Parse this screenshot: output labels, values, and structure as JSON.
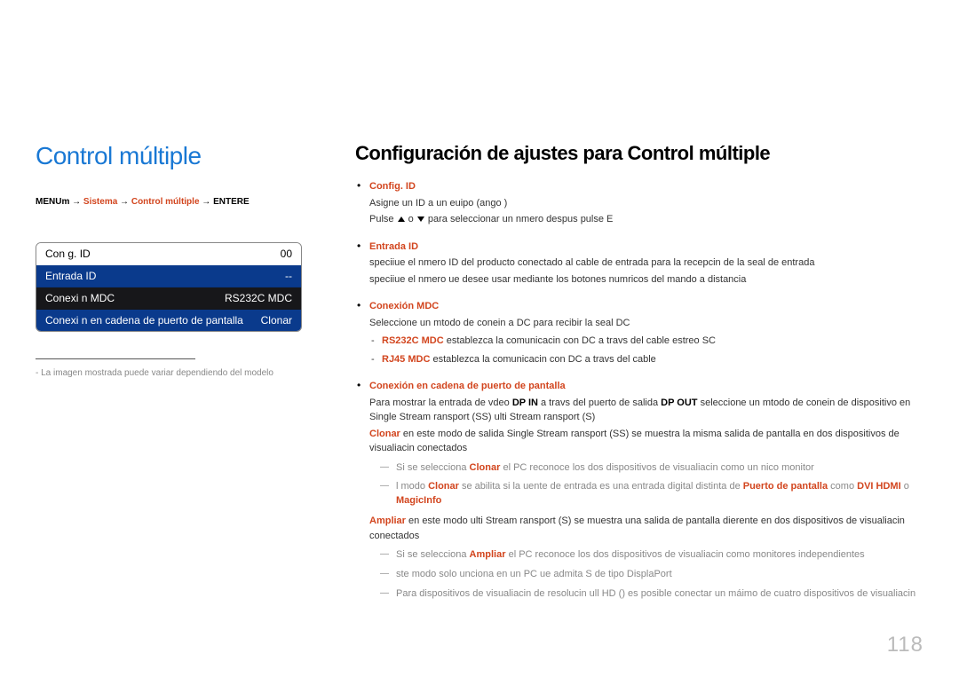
{
  "page_number": "118",
  "left": {
    "title": "Control múltiple",
    "nav": {
      "menu": "MENU",
      "m": "m",
      "arrow": " → ",
      "sistema": "Sistema",
      "control": "Control múltiple",
      "enter": "ENTER",
      "e": "E"
    },
    "menu_rows": [
      {
        "label": "Con g. ID",
        "value": "00",
        "cls": ""
      },
      {
        "label": "Entrada ID",
        "value": "--",
        "cls": "hl"
      },
      {
        "label": "Conexi n MDC",
        "value": "RS232C MDC",
        "cls": "dark"
      },
      {
        "label": "Conexi n en cadena de puerto de pantalla",
        "value": "Clonar",
        "cls": "hl"
      }
    ],
    "caption": "La imagen mostrada puede variar dependiendo del modelo"
  },
  "right": {
    "title": "Configuración de ajustes para Control múltiple",
    "items": {
      "config_id": {
        "title": "Config. ID",
        "line1a": "Asigne un ID a un euipo (ango ",
        "line1b": ")",
        "line2a": "Pulse ",
        "line2b": " o ",
        "line2c": " para seleccionar un nmero  despus pulse ",
        "line2d": "E"
      },
      "entrada_id": {
        "title": "Entrada ID",
        "line1": "speciiue el nmero ID del producto conectado al cable de entrada para la recepcin de la seal de entrada",
        "line2": "speciiue el nmero ue desee usar mediante los botones numricos del mando a distancia"
      },
      "conexion_mdc": {
        "title": "Conexión MDC",
        "intro": "Seleccione un mtodo de conein a DC para recibir la seal DC",
        "sub1_title": "RS232C MDC",
        "sub1_text": " establezca la comunicacin con DC a travs del cable estreo SC",
        "sub2_title": "RJ45 MDC",
        "sub2_text": " establezca la comunicacin con DC a travs del cable"
      },
      "daisy": {
        "title": "Conexión en cadena de puerto de pantalla",
        "intro_a": "Para mostrar la entrada de vdeo ",
        "dp_in": "DP IN",
        "intro_b": " a travs del puerto de salida ",
        "dp_out": "DP OUT",
        "intro_c": " seleccione un mtodo de conein de dispositivo en Single Stream ransport (SS)  ulti Stream ransport (S)",
        "clonar_title": "Clonar",
        "clonar_text": " en este modo de salida Single Stream ransport (SS) se muestra la misma salida de pantalla en dos dispositivos de visualiacin conectados",
        "note1_a": "Si se selecciona ",
        "note1_b": "Clonar",
        "note1_c": " el PC reconoce los dos dispositivos de visualiacin como un nico monitor",
        "note2_a": "l modo ",
        "note2_b": "Clonar",
        "note2_c": " se abilita si la uente de entrada es una entrada digital distinta de ",
        "note2_d": "Puerto de pantalla",
        "note2_e": " como ",
        "note2_f": "DVI",
        "note2_g": "HDMI",
        "note2_h": " o ",
        "note2_i": "MagicInfo",
        "ampliar_title": "Ampliar",
        "ampliar_text": " en este modo ulti Stream ransport (S) se muestra una salida de pantalla dierente en dos dispositivos de visualiacin conectados",
        "note3_a": "Si se selecciona ",
        "note3_b": "Ampliar",
        "note3_c": " el PC reconoce los dos dispositivos de visualiacin como monitores independientes",
        "note4": "ste modo solo unciona en un PC ue admita S de tipo DisplaPort ",
        "note5": "Para dispositivos de visualiacin de resolucin ull HD () es posible conectar un máimo de cuatro dispositivos de visualiacin"
      }
    }
  }
}
